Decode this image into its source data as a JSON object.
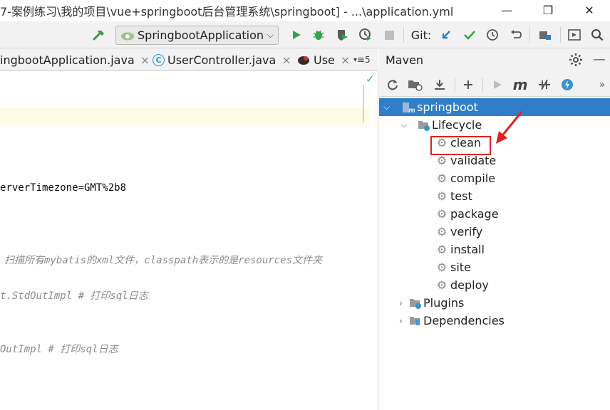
{
  "window": {
    "title": "7-案例练习\\我的项目\\vue+springboot后台管理系统\\springboot] - ...\\application.yml",
    "minimize": "—",
    "maximize": "❐",
    "close": "✕"
  },
  "toolbar": {
    "run_config": "SpringbootApplication",
    "git_label": "Git:"
  },
  "editor_tabs": [
    {
      "label": "ingbootApplication.java",
      "close": "×"
    },
    {
      "label": "UserController.java",
      "close": "×"
    },
    {
      "label": "Use",
      "close": "×"
    }
  ],
  "tab_overflow": "5",
  "editor": {
    "lines": [
      {
        "text": "erverTimezone=GMT%2b8",
        "comment": false
      },
      {
        "text": "扫描所有mybatis的xml文件，classpath表示的是resources文件夹",
        "comment": true
      },
      {
        "text": "t.StdOutImpl  # 打印sql日志",
        "comment": true
      },
      {
        "text": "OutImpl  # 打印sql日志",
        "comment": true
      }
    ]
  },
  "maven": {
    "title": "Maven",
    "project": "springboot",
    "lifecycle_label": "Lifecycle",
    "lifecycle": [
      "clean",
      "validate",
      "compile",
      "test",
      "package",
      "verify",
      "install",
      "site",
      "deploy"
    ],
    "plugins_label": "Plugins",
    "dependencies_label": "Dependencies",
    "highlighted_goal": "clean"
  },
  "colors": {
    "selection": "#2f7ec7",
    "highlight_box": "#e02020",
    "run_green": "#35a34a",
    "git_blue": "#2f7ec7"
  }
}
